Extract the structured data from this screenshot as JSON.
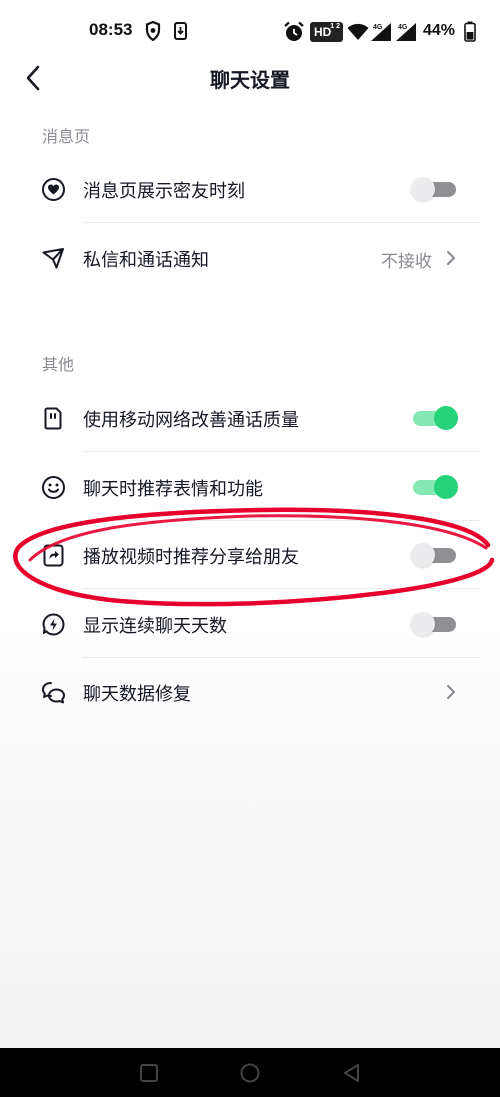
{
  "status_bar": {
    "time": "08:53",
    "hd_label": "HD",
    "hd_sub": "1 2",
    "network_1": "4G",
    "network_2": "4G",
    "battery": "44%"
  },
  "nav": {
    "title": "聊天设置"
  },
  "sections": [
    {
      "title": "消息页",
      "items": [
        {
          "label": "消息页展示密友时刻",
          "icon": "heart-circle-icon",
          "control": "toggle",
          "on": false
        },
        {
          "label": "私信和通话通知",
          "icon": "paper-plane-icon",
          "control": "link",
          "value": "不接收"
        }
      ]
    },
    {
      "title": "其他",
      "items": [
        {
          "label": "使用移动网络改善通话质量",
          "icon": "sim-card-icon",
          "control": "toggle",
          "on": true
        },
        {
          "label": "聊天时推荐表情和功能",
          "icon": "smiley-icon",
          "control": "toggle",
          "on": true
        },
        {
          "label": "播放视频时推荐分享给朋友",
          "icon": "share-box-icon",
          "control": "toggle",
          "on": false
        },
        {
          "label": "显示连续聊天天数",
          "icon": "flame-badge-icon",
          "control": "toggle",
          "on": false
        },
        {
          "label": "聊天数据修复",
          "icon": "chat-bubbles-icon",
          "control": "link",
          "value": ""
        }
      ]
    }
  ],
  "colors": {
    "toggle_on": "#27d37a",
    "toggle_on_track": "#84e8b4",
    "toggle_off_track": "#8f8f94",
    "annotation": "#e8002d",
    "secondary_text": "#8a8b91"
  }
}
